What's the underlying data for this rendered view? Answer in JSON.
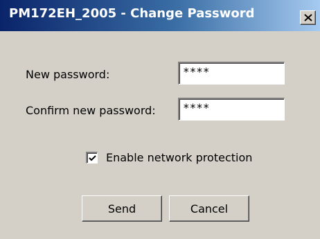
{
  "window": {
    "title": "PM172EH_2005 - Change Password",
    "close_icon": "close-icon"
  },
  "form": {
    "new_password_label": "New password:",
    "new_password_value": "****",
    "confirm_password_label": "Confirm new password:",
    "confirm_password_value": "****",
    "network_protection_label": "Enable network protection",
    "network_protection_checked": true
  },
  "buttons": {
    "send_label": "Send",
    "cancel_label": "Cancel"
  }
}
